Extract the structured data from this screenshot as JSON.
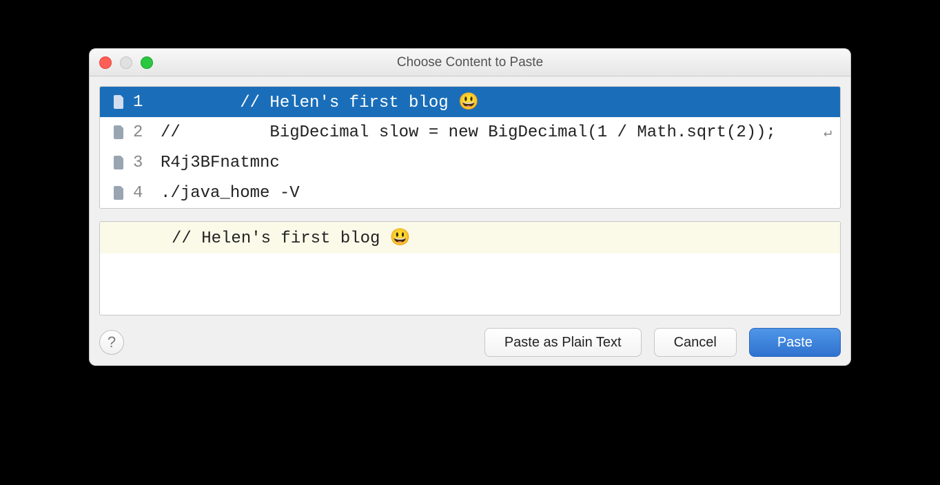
{
  "window": {
    "title": "Choose Content to Paste"
  },
  "clipboard_items": [
    {
      "index": "1",
      "content": "        // Helen's first blog 😃",
      "selected": true,
      "wrap": false
    },
    {
      "index": "2",
      "content": "//         BigDecimal slow = new BigDecimal(1 / Math.sqrt(2));",
      "selected": false,
      "wrap": true
    },
    {
      "index": "3",
      "content": "R4j3BFnatmnc",
      "selected": false,
      "wrap": false
    },
    {
      "index": "4",
      "content": "./java_home -V",
      "selected": false,
      "wrap": false
    }
  ],
  "preview": {
    "text": "// Helen's first blog 😃"
  },
  "buttons": {
    "help_label": "?",
    "paste_plain": "Paste as Plain Text",
    "cancel": "Cancel",
    "paste": "Paste"
  }
}
